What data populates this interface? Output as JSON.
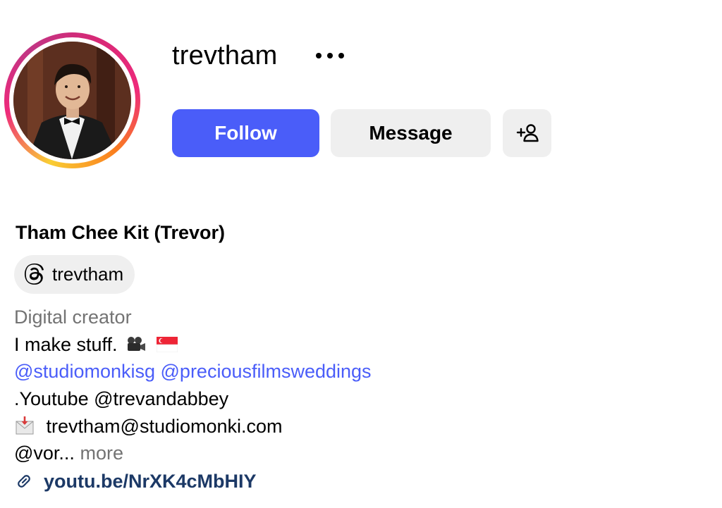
{
  "profile": {
    "username": "trevtham",
    "full_name": "Tham Chee Kit (Trevor)",
    "avatar_icon": "profile-photo"
  },
  "actions": {
    "follow_label": "Follow",
    "message_label": "Message",
    "more_icon": "more-horizontal-icon",
    "add_user_icon": "add-user-icon"
  },
  "threads": {
    "handle": "trevtham",
    "icon": "threads-icon"
  },
  "bio": {
    "category": "Digital creator",
    "line1_text": "I make stuff.",
    "mention_1": "@studiomonkisg",
    "mention_2": "@preciousfilmsweddings",
    "line3": ".Youtube @trevandabbey",
    "email": "trevtham@studiomonki.com",
    "line5_text": "@vor...",
    "more_label": "more",
    "link": "youtu.be/NrXK4cMbHIY"
  },
  "colors": {
    "follow_button": "#4a5df9",
    "secondary_button": "#efefef",
    "mention_link": "#4a5df9",
    "external_link": "#1c3966",
    "muted_text": "#737373"
  }
}
